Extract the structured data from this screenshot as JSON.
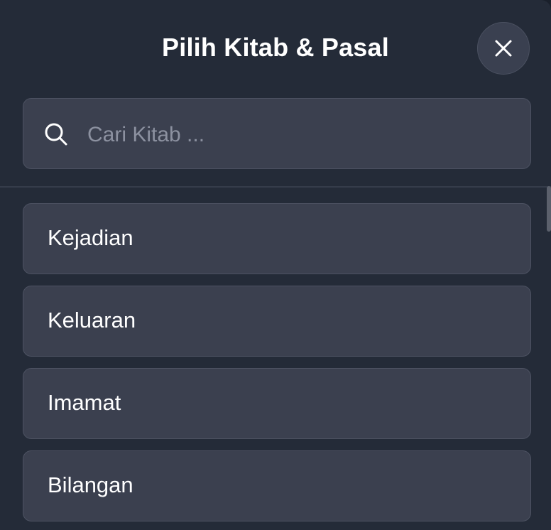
{
  "header": {
    "title": "Pilih Kitab & Pasal",
    "close_icon": "close-icon"
  },
  "search": {
    "placeholder": "Cari Kitab ...",
    "value": "",
    "icon": "search-icon"
  },
  "books": [
    {
      "label": "Kejadian"
    },
    {
      "label": "Keluaran"
    },
    {
      "label": "Imamat"
    },
    {
      "label": "Bilangan"
    }
  ],
  "colors": {
    "background": "#242b38",
    "card": "#3b404f",
    "text": "#ffffff",
    "placeholder": "#8c91a0"
  }
}
